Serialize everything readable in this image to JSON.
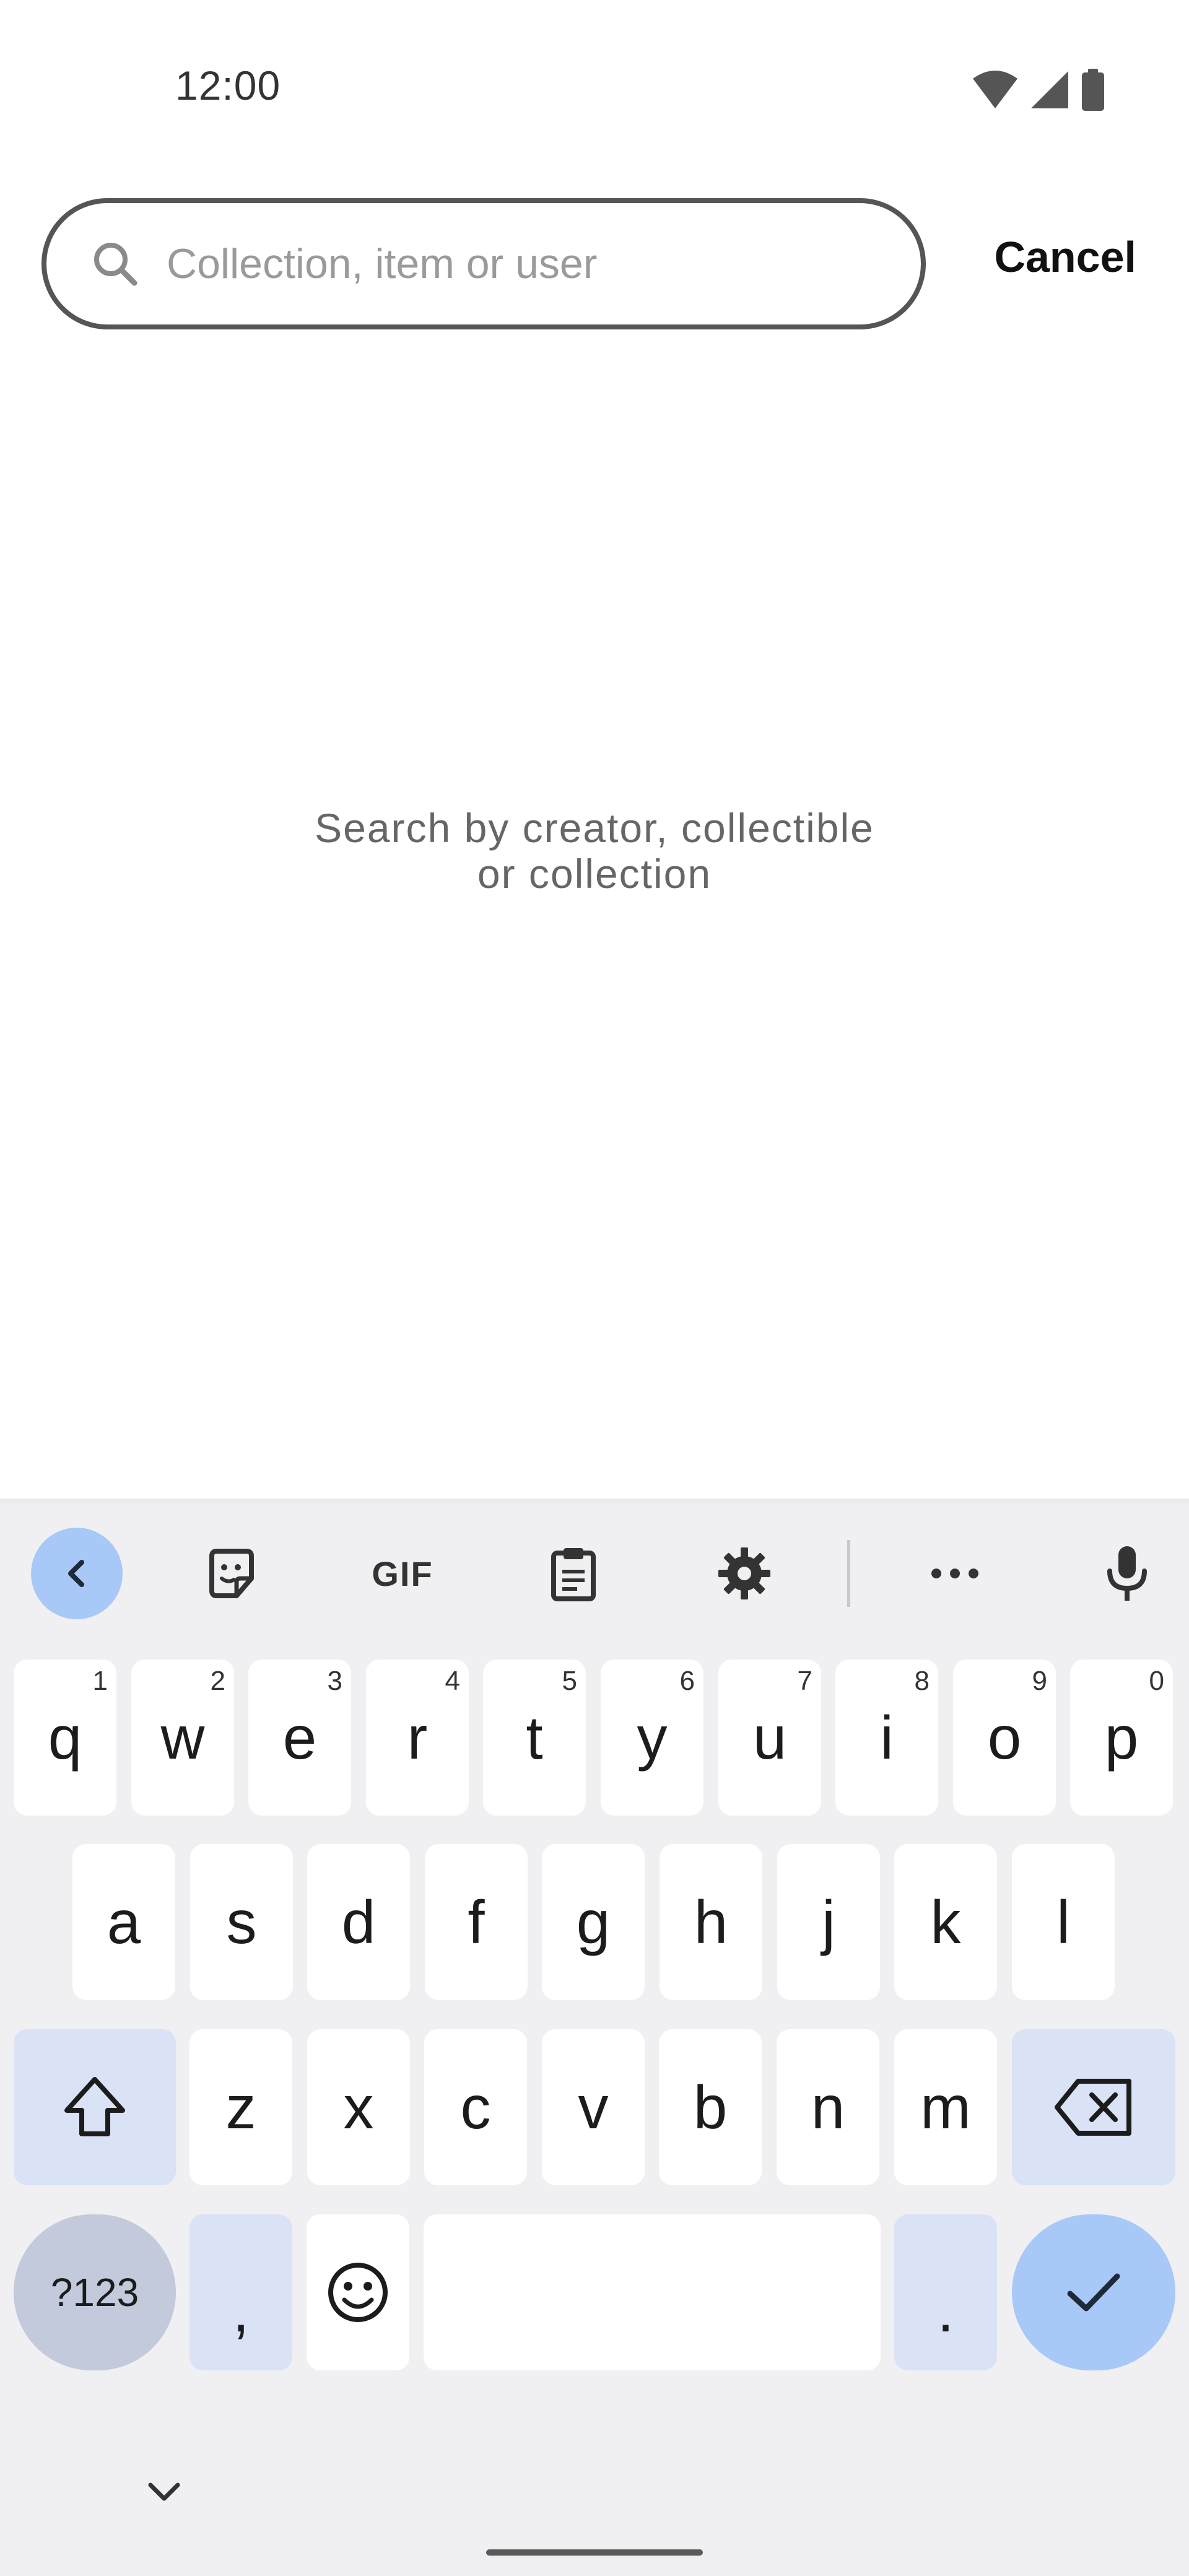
{
  "status_bar": {
    "time": "12:00",
    "icons": [
      "wifi-icon",
      "cell-signal-icon",
      "battery-icon"
    ]
  },
  "search": {
    "placeholder": "Collection, item or user",
    "value": "",
    "cancel_label": "Cancel"
  },
  "empty_state": {
    "line1": "Search by creator, collectible",
    "line2": "or collection"
  },
  "keyboard": {
    "toolbar": {
      "items": [
        "chevron-left-icon",
        "sticker-icon",
        "gif-button",
        "clipboard-icon",
        "gear-icon",
        "more-horiz-icon",
        "microphone-icon"
      ],
      "gif_label": "GIF"
    },
    "row1": [
      {
        "key": "q",
        "hint": "1"
      },
      {
        "key": "w",
        "hint": "2"
      },
      {
        "key": "e",
        "hint": "3"
      },
      {
        "key": "r",
        "hint": "4"
      },
      {
        "key": "t",
        "hint": "5"
      },
      {
        "key": "y",
        "hint": "6"
      },
      {
        "key": "u",
        "hint": "7"
      },
      {
        "key": "i",
        "hint": "8"
      },
      {
        "key": "o",
        "hint": "9"
      },
      {
        "key": "p",
        "hint": "0"
      }
    ],
    "row2": [
      "a",
      "s",
      "d",
      "f",
      "g",
      "h",
      "j",
      "k",
      "l"
    ],
    "row3": [
      "z",
      "x",
      "c",
      "v",
      "b",
      "n",
      "m"
    ],
    "bottom": {
      "symbols_label": "?123",
      "comma": ",",
      "period": ".",
      "space": ""
    }
  },
  "colors": {
    "accent": "#a8c8f8",
    "modifier_key": "#d9e3f5",
    "symbols_key": "#c2cadb",
    "keyboard_bg": "#f0f0f3"
  }
}
